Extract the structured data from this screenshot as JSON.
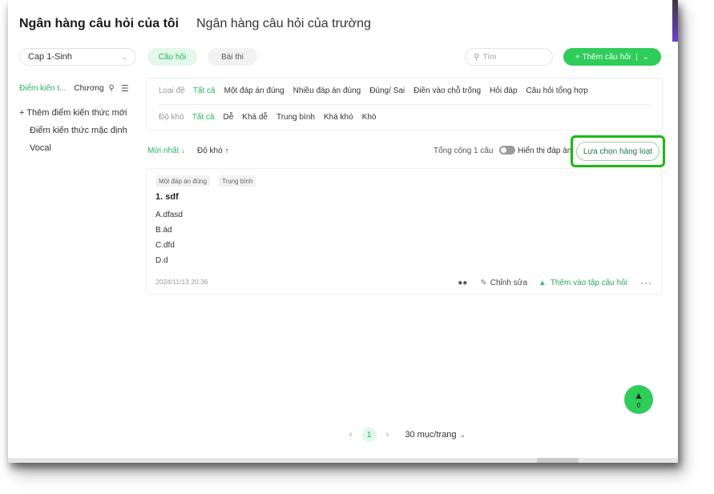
{
  "header": {
    "tabs": [
      {
        "label": "Ngân hàng câu hỏi của tôi",
        "active": true
      },
      {
        "label": "Ngân hàng câu hỏi của trường",
        "active": false
      }
    ]
  },
  "toolbar": {
    "subject_select": "Cap 1-Sinh",
    "tab_questions": "Câu hỏi",
    "tab_exams": "Bài thi",
    "search_placeholder": "Tìm",
    "add_button": "Thêm câu hỏi",
    "add_button_separator": "|"
  },
  "sidebar": {
    "tab_knowledge": "Điểm kiến t...",
    "tab_chapter": "Chương",
    "items": [
      "+ Thêm điểm kiến thức mới",
      "Điểm kiến thức mặc định",
      "Vocal"
    ]
  },
  "filters": {
    "type_label": "Loại đề",
    "types": [
      "Tất cả",
      "Một đáp án đúng",
      "Nhiều đáp án đúng",
      "Đúng/ Sai",
      "Điền vào chỗ trống",
      "Hỏi đáp",
      "Câu hỏi tổng hợp"
    ],
    "difficulty_label": "Độ khó",
    "difficulties": [
      "Tất cả",
      "Dễ",
      "Khá dễ",
      "Trung bình",
      "Khá khó",
      "Khó"
    ]
  },
  "sortbar": {
    "newest": "Mới nhất ↓",
    "difficulty": "Độ khó ↑",
    "total": "Tổng cộng 1 câu",
    "show_answers": "Hiển thị đáp án",
    "bulk_select": "Lựa chọn hàng loạt"
  },
  "question": {
    "tags": [
      "Một đáp án đúng",
      "Trung bình"
    ],
    "title": "1. sdf",
    "options": [
      "A.dfasd",
      "B.ád",
      "C.dfd",
      "D.d"
    ],
    "date": "2024/11/13 20:36",
    "edit": "Chỉnh sửa",
    "add_to_set": "Thêm vào tập câu hỏi"
  },
  "basket": {
    "count": "0"
  },
  "pagination": {
    "current": "1",
    "per_page": "30 mục/trang"
  },
  "colors": {
    "accent": "#2ecc59",
    "accent_text": "#26b45e",
    "highlight": "#1db80f"
  }
}
